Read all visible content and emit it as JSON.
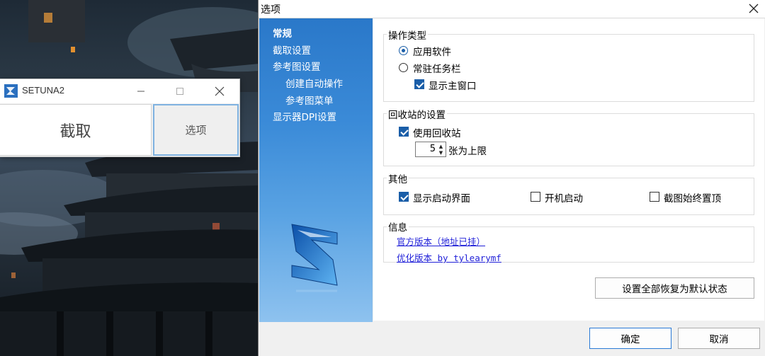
{
  "setuna_window": {
    "title": "SETUNA2",
    "capture_label": "截取",
    "options_label": "选项"
  },
  "dialog": {
    "title": "选项",
    "nav": [
      {
        "label": "常规",
        "active": true
      },
      {
        "label": "截取设置",
        "active": false
      },
      {
        "label": "参考图设置",
        "active": false
      },
      {
        "label": "创建自动操作",
        "active": false
      },
      {
        "label": "参考图菜单",
        "active": false
      },
      {
        "label": "显示器DPI设置",
        "active": false
      }
    ],
    "operation_type": {
      "title": "操作类型",
      "option_app": "应用软件",
      "option_tray": "常驻任务栏",
      "show_main_window": "显示主窗口"
    },
    "recycle": {
      "title": "回收站的设置",
      "use_recycle": "使用回收站",
      "limit_value": "5",
      "limit_label": "张为上限"
    },
    "other": {
      "title": "其他",
      "splash": "显示启动界面",
      "autostart": "开机启动",
      "topmost": "截图始终置顶"
    },
    "info": {
      "title": "信息",
      "official_link": "官方版本（地址已挂）",
      "optimized_link": "优化版本 by tylearymf"
    },
    "reset_button": "设置全部恢复为默认状态",
    "ok_button": "确定",
    "cancel_button": "取消"
  },
  "accent_color": "#1a5ea8",
  "nav_gradient": [
    "#2a78c9",
    "#8ec2ef"
  ]
}
